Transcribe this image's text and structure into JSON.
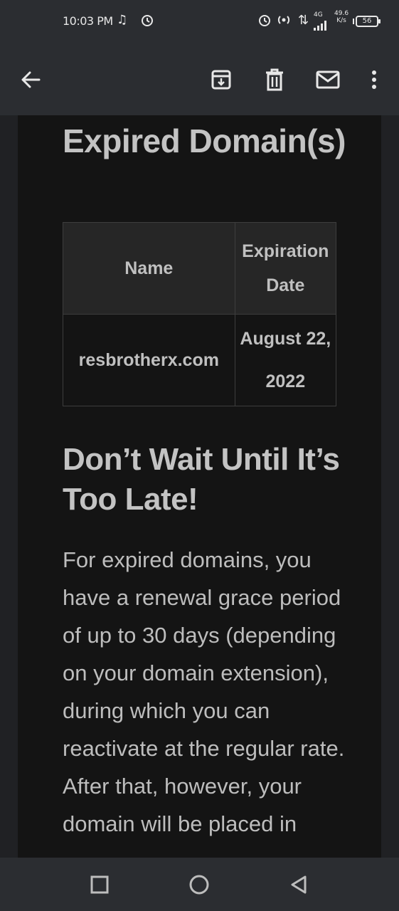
{
  "status_bar": {
    "time": "10:03 PM",
    "network_type": "4G",
    "speed_value": "49.6",
    "speed_unit": "K/s",
    "battery_level": "56"
  },
  "toolbar": {
    "back_icon": "arrow-left-icon",
    "archive_icon": "archive-icon",
    "delete_icon": "trash-icon",
    "mark_unread_icon": "mail-icon",
    "more_icon": "more-vertical-icon"
  },
  "email": {
    "heading": "Expired Domain(s)",
    "table": {
      "headers": [
        "Name",
        "Expiration Date"
      ],
      "rows": [
        {
          "name": "resbrotherx.com",
          "expiration_date": "August 22, 2022"
        }
      ]
    },
    "subheading": "Don’t Wait Until It’s Too Late!",
    "paragraph": "For expired domains, you have a renewal grace period of up to 30 days (depending on your domain extension), during which you can reactivate at the regular rate. After that, however, your domain will be placed in"
  },
  "colors": {
    "chrome": "#2b2d31",
    "mail_background": "#141414",
    "text": "#c3c3c3"
  }
}
